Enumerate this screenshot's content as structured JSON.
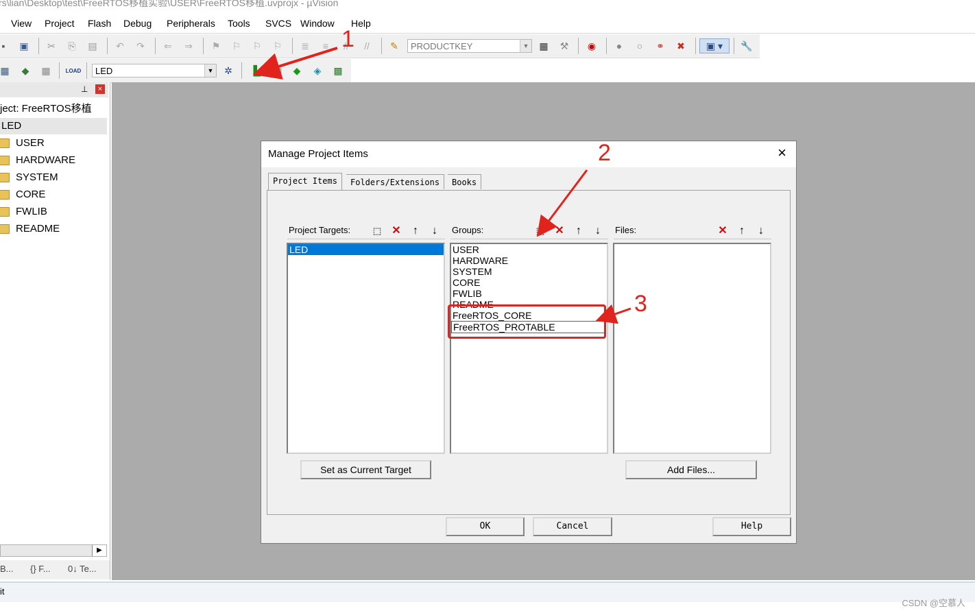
{
  "window": {
    "title": "rs\\lian\\Desktop\\test\\FreeRTOS移植实验\\USER\\FreeRTOS移植.uvprojx - µVision"
  },
  "menu": [
    "View",
    "Project",
    "Flash",
    "Debug",
    "Peripherals",
    "Tools",
    "SVCS",
    "Window",
    "Help"
  ],
  "toolbar1": {
    "productkey": "PRODUCTKEY"
  },
  "toolbar2": {
    "target": "LED",
    "load_label": "LOAD"
  },
  "project_panel": {
    "project": "ject: FreeRTOS移植",
    "target": "LED",
    "groups": [
      "USER",
      "HARDWARE",
      "SYSTEM",
      "CORE",
      "FWLIB",
      "README"
    ],
    "tabs": [
      "B...",
      "{} F...",
      "0↓ Te..."
    ]
  },
  "statusbar": {
    "text": "it"
  },
  "dialog": {
    "title": "Manage Project Items",
    "tabs": [
      "Project Items",
      "Folders/Extensions",
      "Books"
    ],
    "targets_label": "Project Targets:",
    "groups_label": "Groups:",
    "files_label": "Files:",
    "targets": [
      "LED"
    ],
    "groups": [
      "USER",
      "HARDWARE",
      "SYSTEM",
      "CORE",
      "FWLIB",
      "README",
      "FreeRTOS_CORE",
      "FreeRTOS_PROTABLE"
    ],
    "set_current_button": "Set as Current Target",
    "add_files_button": "Add Files...",
    "ok_button": "OK",
    "cancel_button": "Cancel",
    "help_button": "Help"
  },
  "annotations": [
    "1",
    "2",
    "3"
  ],
  "watermark": "CSDN @空慕人",
  "colors": {
    "annotation": "#e0231c",
    "selection": "#0078d7",
    "workspace": "#ababab"
  }
}
